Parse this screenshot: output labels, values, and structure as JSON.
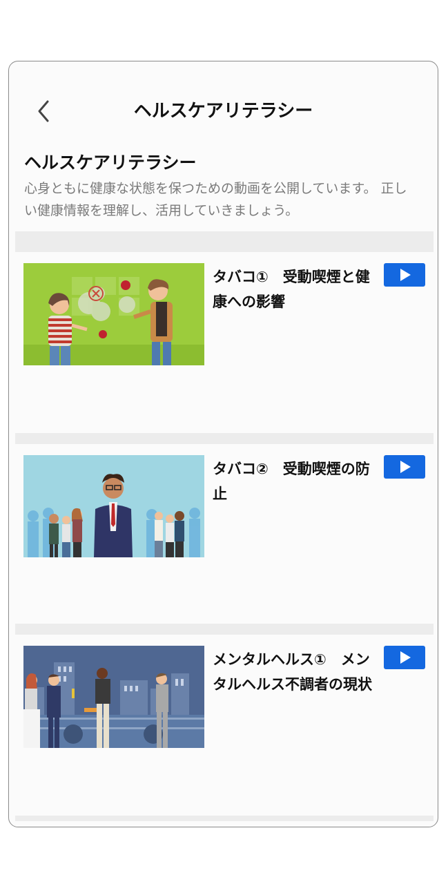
{
  "header": {
    "title": "ヘルスケアリテラシー"
  },
  "intro": {
    "title": "ヘルスケアリテラシー",
    "description": "心身ともに健康な状態を保つための動画を公開しています。 正しい健康情報を理解し、活用していきましょう。"
  },
  "videos": [
    {
      "title": "タバコ①　受動喫煙と健康への影響"
    },
    {
      "title": "タバコ②　受動喫煙の防止"
    },
    {
      "title": "メンタルヘルス①　メンタルヘルス不調者の現状"
    }
  ],
  "colors": {
    "accent": "#1468e0",
    "separator": "#ececec",
    "muted_text": "#7a7a7a"
  },
  "icons": {
    "back": "chevron-left-icon",
    "play": "play-icon"
  }
}
